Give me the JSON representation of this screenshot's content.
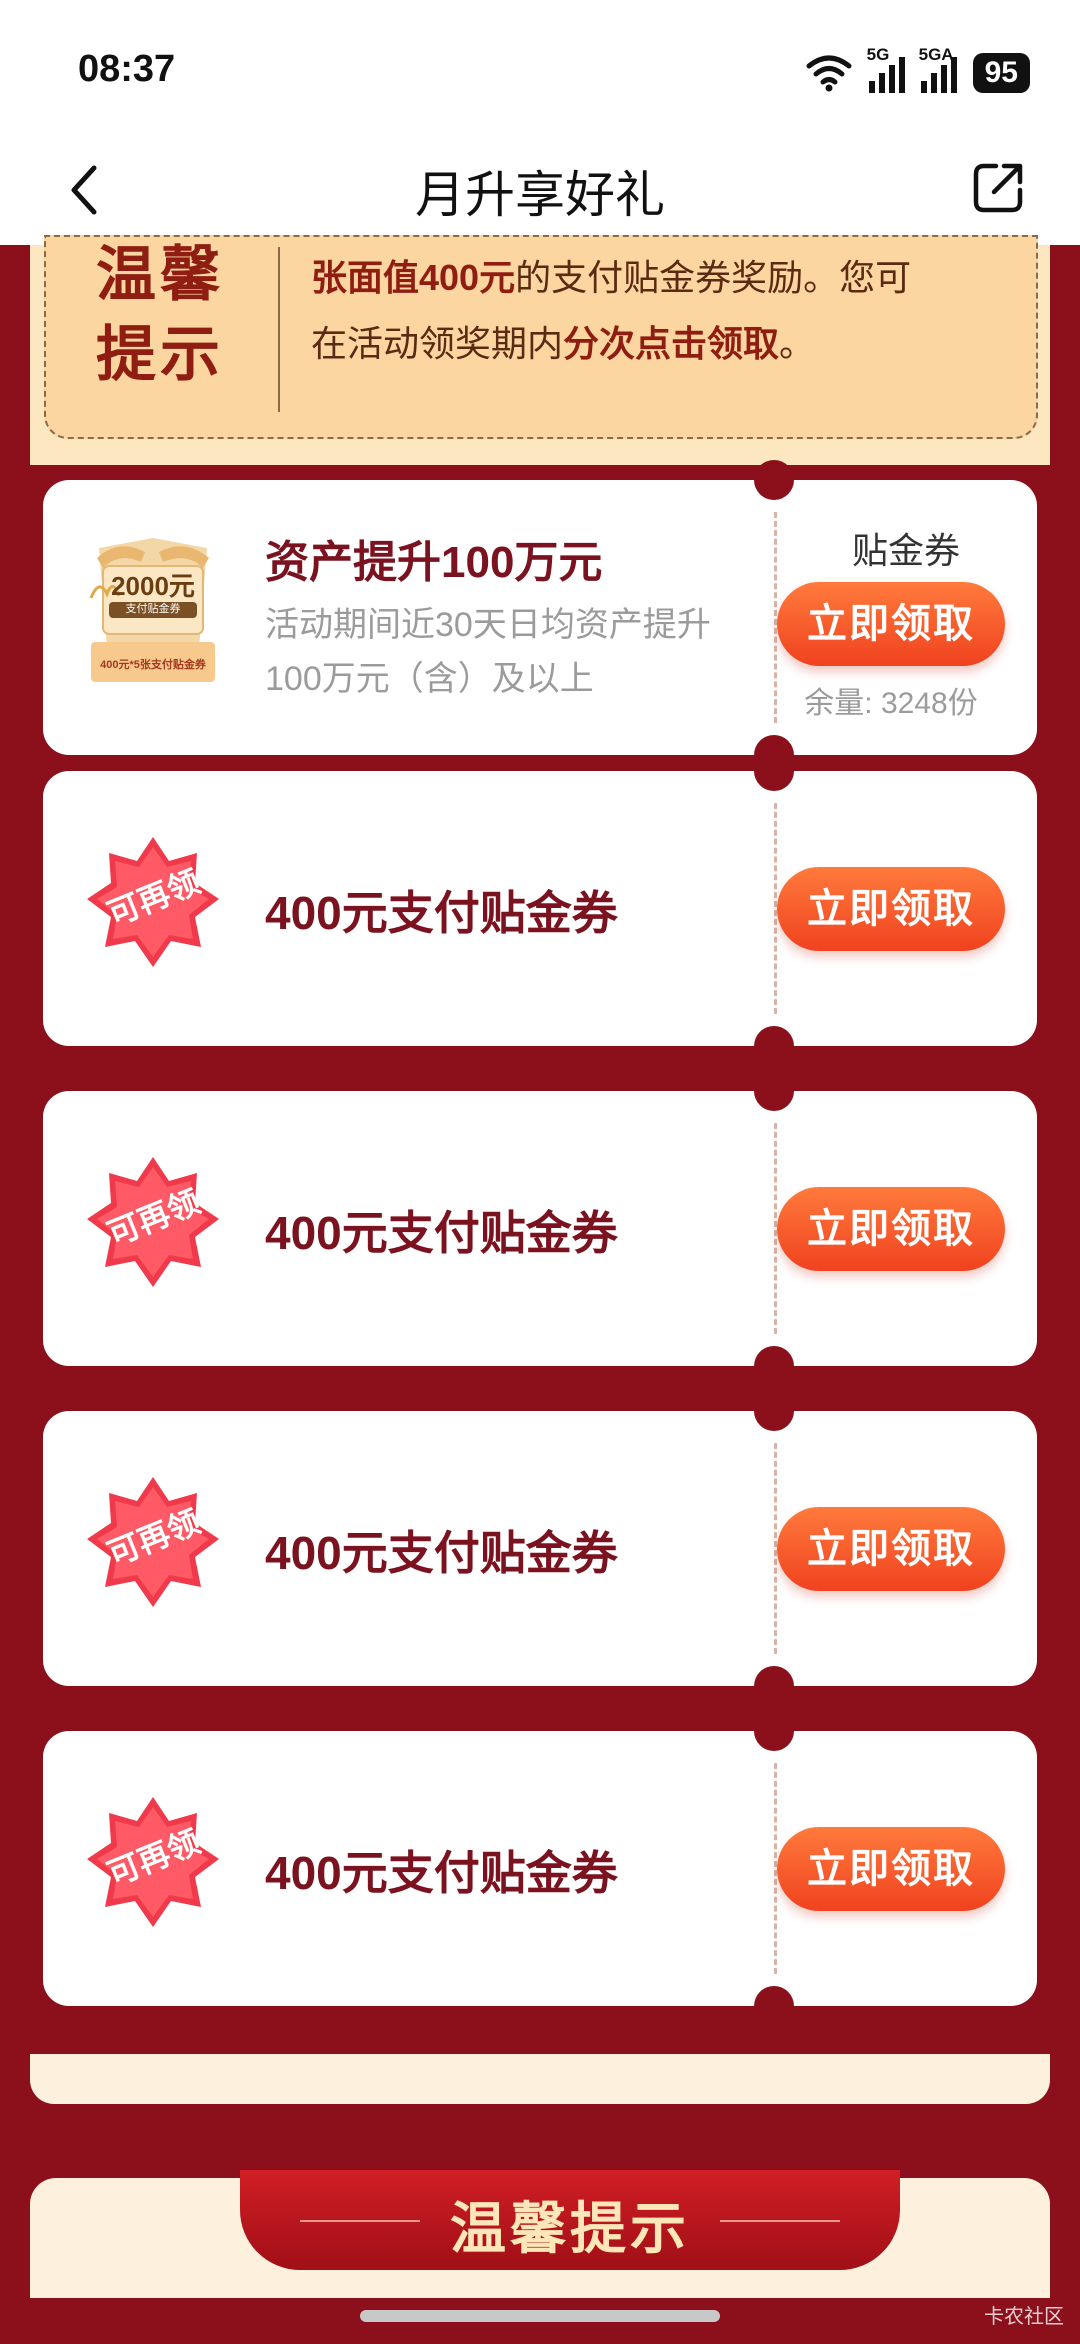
{
  "status_bar": {
    "time": "08:37",
    "sig1": "5G",
    "sig2": "5GA",
    "battery": "95"
  },
  "header": {
    "title": "月升享好礼"
  },
  "notice": {
    "title": "温馨提示",
    "line2_bold": "张面值400元",
    "line2_rest": "的支付贴金券奖励。您可",
    "line3_pre": "在活动领奖期内",
    "line3_bold": "分次点击领取",
    "line3_end": "。"
  },
  "grand_prize": {
    "title": "资产提升100万元",
    "description": "活动期间近30天日均资产提升100万元（含）及以上",
    "label": "贴金券",
    "button": "立即领取",
    "remaining": "余量: 3248份",
    "gift_amount": "2000元",
    "gift_sub": "支付贴金券",
    "gift_bottom": "400元*5张支付贴金券"
  },
  "coupons": [
    {
      "badge": "可再领",
      "name": "400元支付贴金券",
      "button": "立即领取"
    },
    {
      "badge": "可再领",
      "name": "400元支付贴金券",
      "button": "立即领取"
    },
    {
      "badge": "可再领",
      "name": "400元支付贴金券",
      "button": "立即领取"
    },
    {
      "badge": "可再领",
      "name": "400元支付贴金券",
      "button": "立即领取"
    }
  ],
  "tips": {
    "title": "温馨提示"
  },
  "watermark": "卡农社区"
}
